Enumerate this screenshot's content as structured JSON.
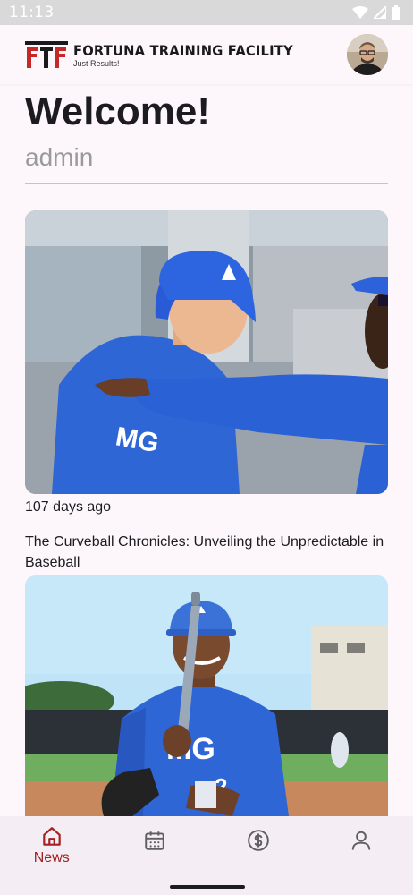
{
  "status_bar": {
    "time": "11:13"
  },
  "header": {
    "brand_title": "FORTUNA TRAINING FACILITY",
    "brand_subtitle": "Just Results!",
    "logo_letters": "FTF"
  },
  "welcome": {
    "heading": "Welcome!",
    "username": "admin"
  },
  "news": [
    {
      "age": "107 days ago",
      "title": "The Curveball Chronicles: Unveiling the Unpredictable in Baseball"
    },
    {
      "age": "",
      "title": ""
    }
  ],
  "bottom_nav": {
    "items": [
      {
        "label": "News",
        "icon": "home-icon",
        "active": true
      },
      {
        "label": "",
        "icon": "calendar-icon",
        "active": false
      },
      {
        "label": "",
        "icon": "dollar-icon",
        "active": false
      },
      {
        "label": "",
        "icon": "person-icon",
        "active": false
      }
    ]
  },
  "colors": {
    "accent": "#a32121",
    "background": "#fdf7fb",
    "nav_background": "#f4edf4",
    "jersey_blue": "#2f66d6"
  }
}
